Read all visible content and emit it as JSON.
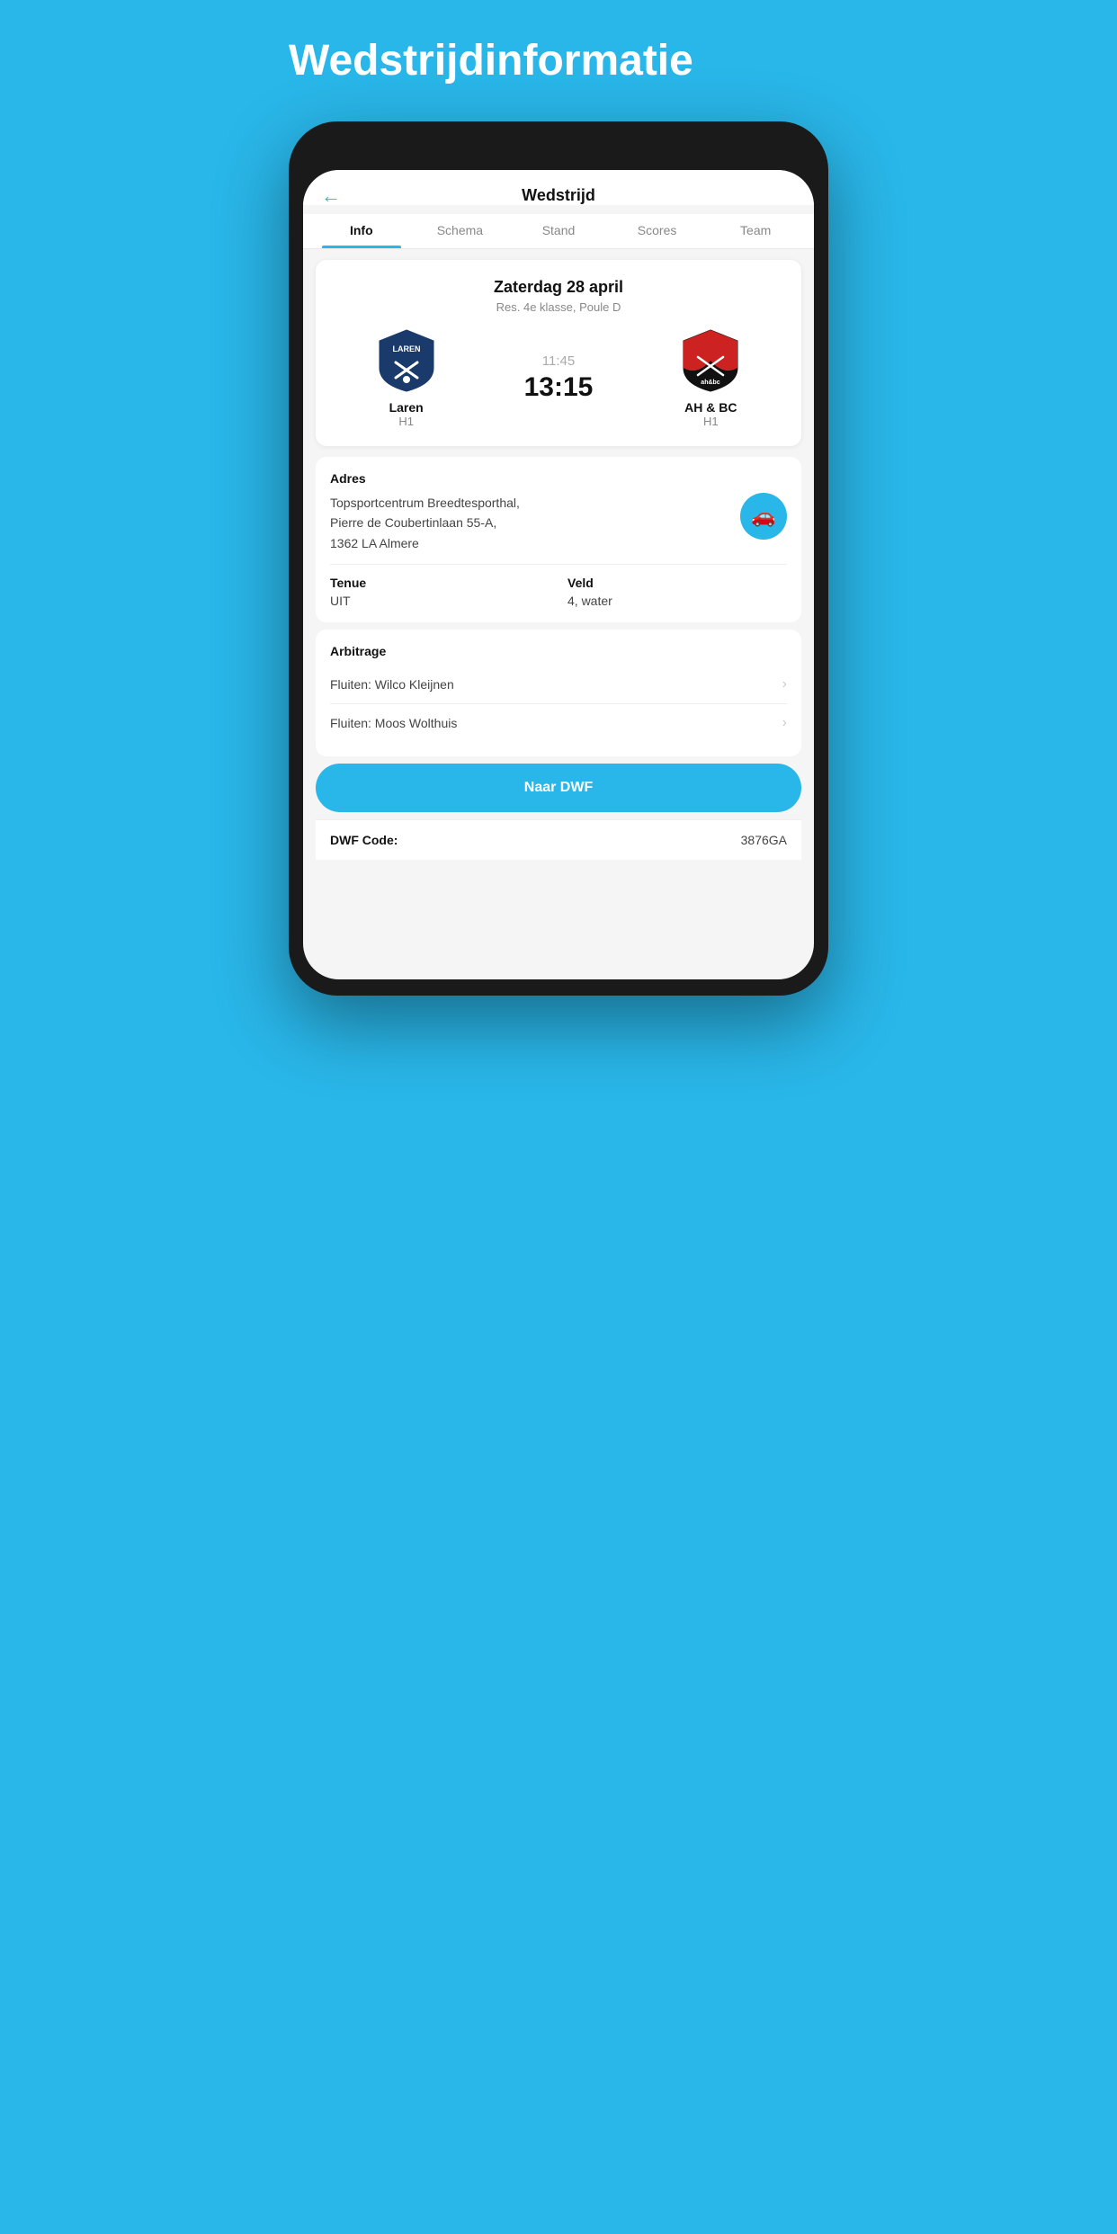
{
  "pageTitle": "Wedstrijdinformatie",
  "header": {
    "backLabel": "←",
    "title": "Wedstrijd"
  },
  "tabs": [
    {
      "label": "Info",
      "active": true
    },
    {
      "label": "Schema",
      "active": false
    },
    {
      "label": "Stand",
      "active": false
    },
    {
      "label": "Scores",
      "active": false
    },
    {
      "label": "Team",
      "active": false
    }
  ],
  "matchCard": {
    "date": "Zaterdag 28 april",
    "class": "Res. 4e klasse, Poule D",
    "homeTeam": {
      "name": "Laren",
      "sub": "H1"
    },
    "awayTeam": {
      "name": "AH & BC",
      "sub": "H1"
    },
    "timeScheduled": "11:45",
    "timeMain": "13:15"
  },
  "addressSection": {
    "label": "Adres",
    "line1": "Topsportcentrum Breedtesporthal,",
    "line2": "Pierre de Coubertinlaan 55-A,",
    "line3": "1362 LA Almere"
  },
  "details": {
    "tenueLabel": "Tenue",
    "tenueValue": "UIT",
    "veldLabel": "Veld",
    "veldValue": "4, water"
  },
  "arbitrage": {
    "label": "Arbitrage",
    "items": [
      {
        "text": "Fluiten: Wilco Kleijnen"
      },
      {
        "text": "Fluiten: Moos Wolthuis"
      }
    ]
  },
  "dwfButton": "Naar DWF",
  "dwfCode": {
    "label": "DWF Code:",
    "value": "3876GA"
  }
}
